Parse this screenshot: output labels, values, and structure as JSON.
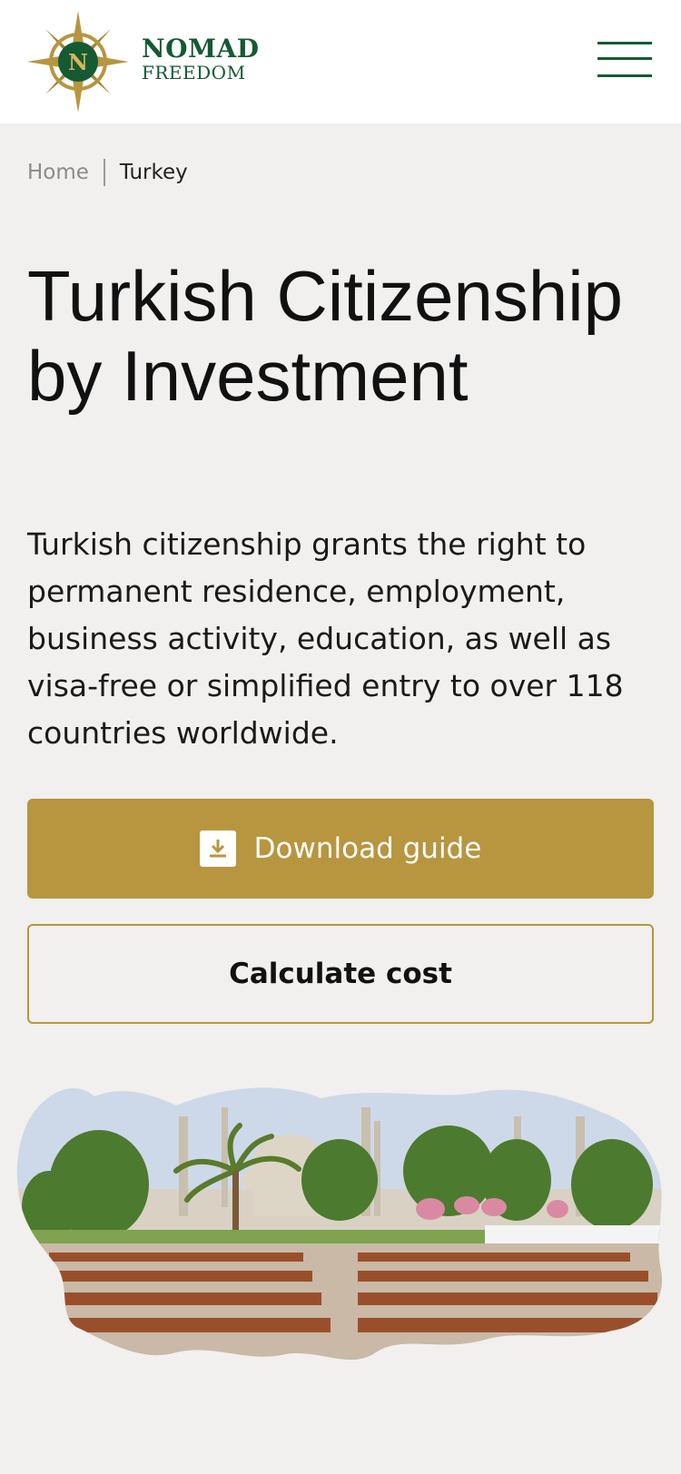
{
  "header": {
    "brand_line1": "NOMAD",
    "brand_line2": "FREEDOM",
    "logo_letter": "N",
    "menu_icon": "hamburger-menu-icon"
  },
  "breadcrumb": {
    "home": "Home",
    "current": "Turkey"
  },
  "hero": {
    "title": "Turkish Citizenship by Investment",
    "description": "Turkish citizenship grants the right to permanent residence, employment, business activity, education, as well as visa-free or simplified entry to over 118 countries worldwide.",
    "download_label": "Download guide",
    "download_icon": "download-icon",
    "calculate_label": "Calculate cost",
    "image_icon": "turkey-map-mosque-image"
  },
  "colors": {
    "brand_green": "#145a32",
    "gold": "#b8953f",
    "background": "#f1f0ee"
  }
}
